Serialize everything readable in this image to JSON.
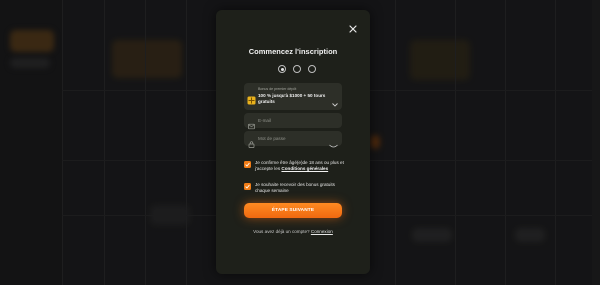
{
  "modal": {
    "title": "Commencez l'inscription",
    "steps": 3,
    "active_step": 1
  },
  "bonus": {
    "label": "Bonus de premier dépôt",
    "value": "100 % jusqu'à $1000 + 50 tours gratuits",
    "icon": "gift-icon"
  },
  "email": {
    "placeholder": "E-mail",
    "icon": "mail-icon"
  },
  "password": {
    "placeholder": "Mot de passe",
    "icon": "lock-icon",
    "toggle_icon": "eye-icon"
  },
  "terms": {
    "checked": true,
    "text": "Je confirme être âgé(e)de 18 ans ou plus et j'accepte les",
    "link": "Conditions générales"
  },
  "newsletter": {
    "checked": true,
    "text": "Je souhaite recevoir des bonus gratuits chaque semaine"
  },
  "cta": {
    "label": "ÉTAPE SUIVANTE"
  },
  "login": {
    "prompt": "Vous avez déjà un compte?",
    "link": "Connexion"
  },
  "colors": {
    "accent": "#f07c16",
    "modal_bg": "#1e201a",
    "field_bg": "#2d2f28"
  }
}
